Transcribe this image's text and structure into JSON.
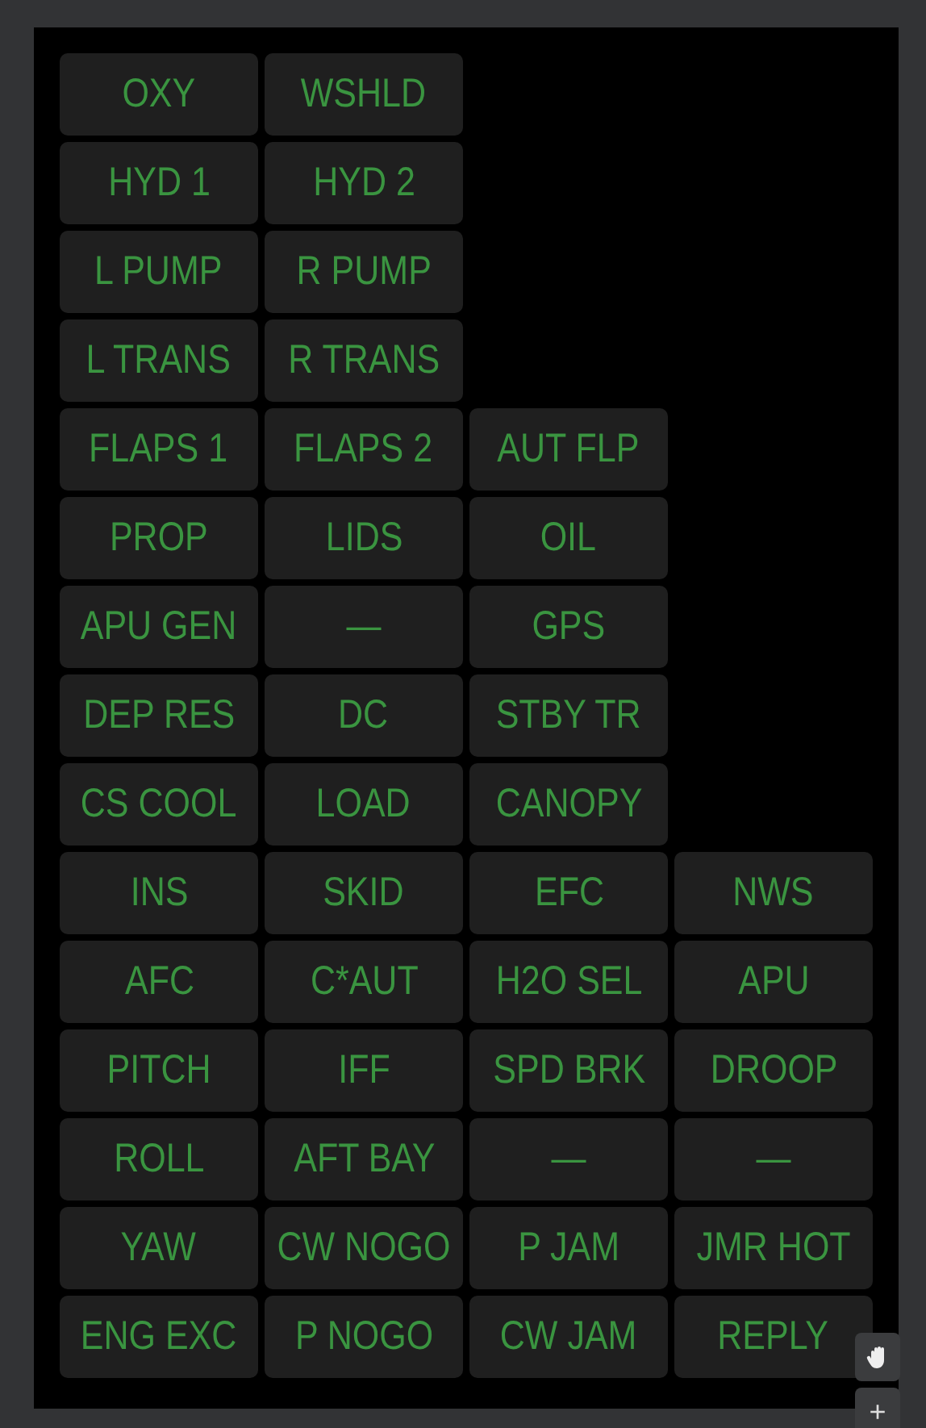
{
  "panel_rows": [
    [
      "OXY",
      "WSHLD"
    ],
    [
      "HYD 1",
      "HYD 2"
    ],
    [
      "L PUMP",
      "R PUMP"
    ],
    [
      "L TRANS",
      "R TRANS"
    ],
    [
      "FLAPS 1",
      "FLAPS 2",
      "AUT FLP"
    ],
    [
      "PROP",
      "LIDS",
      "OIL"
    ],
    [
      "APU GEN",
      "—",
      "GPS"
    ],
    [
      "DEP RES",
      "DC",
      "STBY TR"
    ],
    [
      "CS COOL",
      "LOAD",
      "CANOPY"
    ],
    [
      "INS",
      "SKID",
      "EFC",
      "NWS"
    ],
    [
      "AFC",
      "C*AUT",
      "H2O SEL",
      "APU"
    ],
    [
      "PITCH",
      "IFF",
      "SPD BRK",
      "DROOP"
    ],
    [
      "ROLL",
      "AFT BAY",
      "—",
      "—"
    ],
    [
      "YAW",
      "CW NOGO",
      "P JAM",
      "JMR HOT"
    ],
    [
      "ENG EXC",
      "P NOGO",
      "CW JAM",
      "REPLY"
    ]
  ],
  "zoom_in_button": "+"
}
